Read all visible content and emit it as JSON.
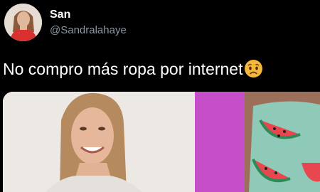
{
  "tweet": {
    "author_name": "San",
    "author_handle": "@Sandralahaye",
    "text": "No compro más ropa por internet",
    "emoji_icon": "worried-face-icon",
    "media_icon": "photo-icon"
  },
  "colors": {
    "background": "#000000",
    "name": "#ffffff",
    "handle": "#8b98a5",
    "emoji": "#f4b73a"
  }
}
